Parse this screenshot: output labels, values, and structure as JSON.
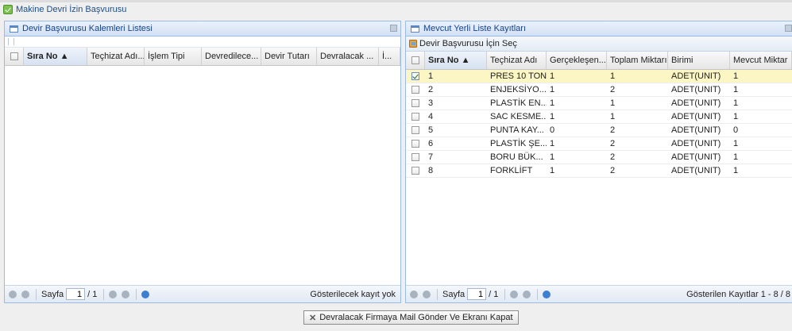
{
  "window_tab": {
    "title": "Makine Devri İzin Başvurusu"
  },
  "left_panel": {
    "title": "Devir Başvurusu Kalemleri Listesi",
    "columns": [
      "Sıra No ▲",
      "Teçhizat Adı...",
      "İşlem Tipi",
      "Devredilece...",
      "Devir Tutarı",
      "Devralacak ...",
      "İ..."
    ],
    "pager": {
      "page_label": "Sayfa",
      "page_value": "1",
      "page_total": "/ 1",
      "info": "Gösterilecek kayıt yok"
    }
  },
  "right_panel": {
    "title": "Mevcut Yerli Liste Kayıtları",
    "toolbar_button": "Devir Başvurusu İçin Seç",
    "columns": [
      "Sıra No ▲",
      "Teçhizat Adı",
      "Gerçekleşen...",
      "Toplam Miktarı",
      "Birimi",
      "Mevcut Miktar"
    ],
    "rows": [
      {
        "no": "1",
        "name": "PRES 10 TON",
        "done": "1",
        "total": "1",
        "unit": "ADET(UNIT)",
        "available": "1",
        "checked": true
      },
      {
        "no": "2",
        "name": "ENJEKSİYO...",
        "done": "1",
        "total": "2",
        "unit": "ADET(UNIT)",
        "available": "1",
        "checked": false
      },
      {
        "no": "3",
        "name": "PLASTİK EN...",
        "done": "1",
        "total": "1",
        "unit": "ADET(UNIT)",
        "available": "1",
        "checked": false
      },
      {
        "no": "4",
        "name": "SAC KESME...",
        "done": "1",
        "total": "1",
        "unit": "ADET(UNIT)",
        "available": "1",
        "checked": false
      },
      {
        "no": "5",
        "name": "PUNTA KAY...",
        "done": "0",
        "total": "2",
        "unit": "ADET(UNIT)",
        "available": "0",
        "checked": false
      },
      {
        "no": "6",
        "name": "PLASTİK ŞE...",
        "done": "1",
        "total": "2",
        "unit": "ADET(UNIT)",
        "available": "1",
        "checked": false
      },
      {
        "no": "7",
        "name": "BORU BÜK...",
        "done": "1",
        "total": "2",
        "unit": "ADET(UNIT)",
        "available": "1",
        "checked": false
      },
      {
        "no": "8",
        "name": "FORKLİFT",
        "done": "1",
        "total": "2",
        "unit": "ADET(UNIT)",
        "available": "1",
        "checked": false
      }
    ],
    "pager": {
      "page_label": "Sayfa",
      "page_value": "1",
      "page_total": "/ 1",
      "info": "Gösterilen Kayıtlar 1 - 8 / 8"
    }
  },
  "footer": {
    "close_button": "Devralacak Firmaya Mail Gönder Ve Ekranı Kapat"
  }
}
